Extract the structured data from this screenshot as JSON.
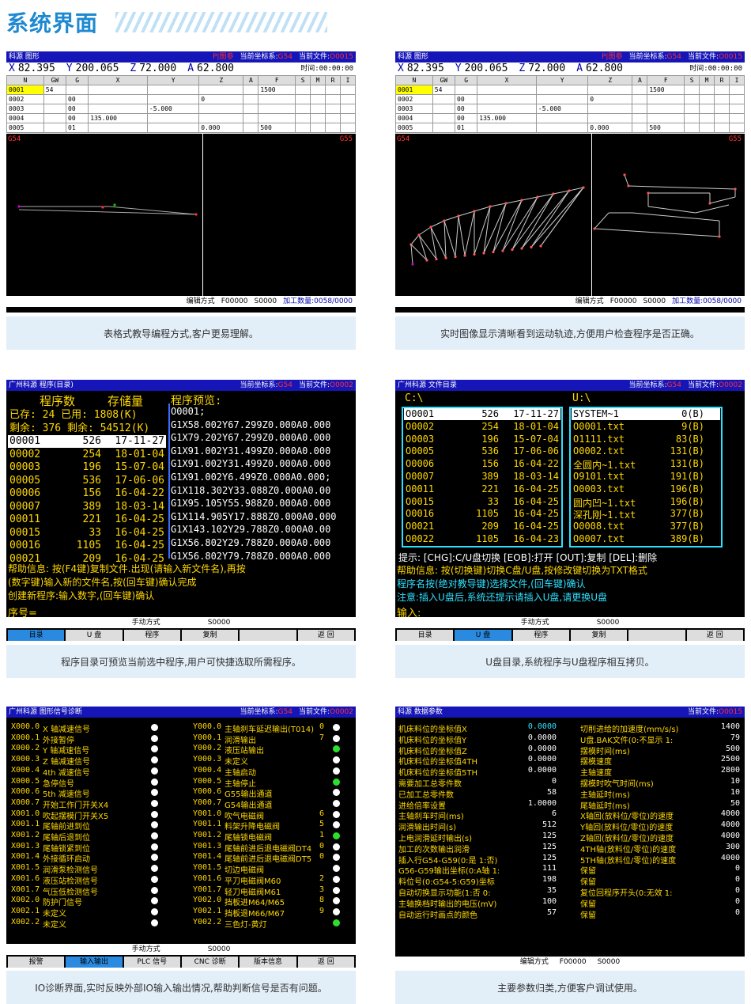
{
  "header": {
    "title": "系统界面"
  },
  "captions": [
    "表格式教导编程方式,客户更易理解。",
    "实时图像显示清晰看到运动轨迹,方便用户检查程序是否正确。",
    "程序目录可预览当前选中程序,用户可快捷选取所需程序。",
    "U盘目录,系统程序与U盘程序相互拷贝。",
    "IO诊断界面,实时反映外部IO输入输出情况,帮助判断信号是否有问题。",
    "主要参数归类,方便客户调试使用。"
  ],
  "graphic": {
    "title": "科源 图形",
    "mode": "P|图参",
    "coord_label": "当前坐标系:",
    "coord_val": "G54",
    "file_label": "当前文件:",
    "file_val": "O0015",
    "x_label": "X",
    "x": "82.395",
    "y_label": "Y",
    "y": "200.065",
    "z_label": "Z",
    "z": "72.000",
    "a_label": "A",
    "a": "62.800",
    "time": "时间:00:00:00",
    "cols": [
      "N",
      "GW",
      "G",
      "X",
      "Y",
      "Z",
      "A",
      "F",
      "S",
      "M",
      "R",
      "I"
    ],
    "rows": [
      [
        "0001",
        "54",
        "",
        "",
        "",
        "",
        "",
        "1500",
        "",
        "",
        "",
        ""
      ],
      [
        "0002",
        "",
        "00",
        "",
        "",
        "0",
        "",
        "",
        "",
        "",
        "",
        ""
      ],
      [
        "0003",
        "",
        "00",
        "",
        "-5.000",
        "",
        "",
        "",
        "",
        "",
        "",
        ""
      ],
      [
        "0004",
        "",
        "00",
        "135.000",
        "",
        "",
        "",
        "",
        "",
        "",
        "",
        ""
      ],
      [
        "0005",
        "",
        "01",
        "",
        "",
        "0.000",
        "",
        "500",
        "",
        "",
        "",
        ""
      ]
    ],
    "view_left": "G54",
    "view_right": "G55",
    "status": [
      "编辑方式",
      "F00000",
      "S0000",
      "加工数量:0058/0000"
    ]
  },
  "proglist": {
    "title": "广州科源 程序(目录)",
    "coord_label": "当前坐标系:",
    "coord_val": "G54",
    "file_label": "当前文件:",
    "file_val": "O0002",
    "h1": "程序数",
    "h2": "存储量",
    "h3": "程序预览:",
    "s1": "已存:   24 已用:  1808(K)",
    "s2": "剩余:  376 剩余: 54512(K)",
    "files": [
      [
        "00001",
        "526",
        "17-11-27"
      ],
      [
        "00002",
        "254",
        "18-01-04"
      ],
      [
        "00003",
        "196",
        "15-07-04"
      ],
      [
        "00005",
        "536",
        "17-06-06"
      ],
      [
        "00006",
        "156",
        "16-04-22"
      ],
      [
        "00007",
        "389",
        "18-03-14"
      ],
      [
        "00011",
        "221",
        "16-04-25"
      ],
      [
        "00015",
        "33",
        "16-04-25"
      ],
      [
        "00016",
        "1105",
        "16-04-25"
      ],
      [
        "00021",
        "209",
        "16-04-25"
      ]
    ],
    "preview": [
      "O0001;",
      "G1X58.002Y67.299Z0.000A0.000",
      "G1X79.202Y67.299Z0.000A0.000",
      "G1X91.002Y31.499Z0.000A0.000",
      "G1X91.002Y31.499Z0.000A0.000",
      "G1X91.002Y6.499Z0.000A0.000;",
      "G1X118.302Y33.088Z0.000A0.00",
      "G1X95.105Y55.988Z0.000A0.000",
      "G1X114.905Y17.888Z0.000A0.000",
      "G1X143.102Y29.788Z0.000A0.00",
      "G1X56.802Y29.788Z0.000A0.000",
      "G1X56.802Y79.788Z0.000A0.000"
    ],
    "help1": "帮助信息: 按(F4键)复制文件.出现(请输入新文件名),再按",
    "help2": "         (数字键)输入新的文件名,按(回车键)确认完成",
    "help3": "         创建新程序:输入数字,(回车键)确认",
    "prompt": "序号=",
    "mode": "手动方式",
    "s": "S0000",
    "buttons": [
      "目录",
      "U 盘",
      "程序",
      "复制",
      "",
      "返 回"
    ]
  },
  "usb": {
    "title": "广州科源 文件目录",
    "coord_label": "当前坐标系:",
    "coord_val": "G54",
    "file_label": "当前文件:",
    "file_val": "O0002",
    "cdrive": "C:\\",
    "udrive": "U:\\",
    "cfiles": [
      [
        "O0001",
        "526",
        "17-11-27"
      ],
      [
        "O0002",
        "254",
        "18-01-04"
      ],
      [
        "O0003",
        "196",
        "15-07-04"
      ],
      [
        "O0005",
        "536",
        "17-06-06"
      ],
      [
        "O0006",
        "156",
        "16-04-22"
      ],
      [
        "O0007",
        "389",
        "18-03-14"
      ],
      [
        "O0011",
        "221",
        "16-04-25"
      ],
      [
        "O0015",
        "33",
        "16-04-25"
      ],
      [
        "O0016",
        "1105",
        "16-04-25"
      ],
      [
        "O0021",
        "209",
        "16-04-25"
      ],
      [
        "O0022",
        "1105",
        "16-04-23"
      ]
    ],
    "ufiles": [
      [
        "SYSTEM~1",
        "0(B)"
      ],
      [
        "O0001.txt",
        "9(B)"
      ],
      [
        "O1111.txt",
        "83(B)"
      ],
      [
        "O0002.txt",
        "131(B)"
      ],
      [
        "全圆内~1.txt",
        "131(B)"
      ],
      [
        "O9101.txt",
        "191(B)"
      ],
      [
        "O0003.txt",
        "196(B)"
      ],
      [
        "圆内凹~1.txt",
        "196(B)"
      ],
      [
        "深孔刚~1.txt",
        "377(B)"
      ],
      [
        "O0008.txt",
        "377(B)"
      ],
      [
        "O0007.txt",
        "389(B)"
      ]
    ],
    "tip": "提示: [CHG]:C/U盘切换 [EOB]:打开 [OUT]:复制 [DEL]:删除",
    "help1": "帮助信息: 按(切换键)切换C盘/U盘,按修改键切换为TXT格式",
    "help2": "         程序名按(绝对教导键)选择文件,(回车键)确认",
    "help3": "         注意:插入U盘后,系统还提示请插入U盘,请更换U盘",
    "prompt": "输入:",
    "mode": "手动方式",
    "s": "S0000",
    "buttons": [
      "目录",
      "U 盘",
      "程序",
      "复制",
      "",
      "返 回"
    ]
  },
  "io": {
    "title": "广州科源 图形信号诊断",
    "coord_label": "当前坐标系:",
    "coord_val": "G54",
    "file_label": "当前文件:",
    "file_val": "O0002",
    "left": [
      [
        "X000.0",
        "X 轴减速信号",
        ""
      ],
      [
        "X000.1",
        "外接暂停",
        ""
      ],
      [
        "X000.2",
        "Y 轴减速信号",
        ""
      ],
      [
        "X000.3",
        "Z 轴减速信号",
        ""
      ],
      [
        "X000.4",
        "4th 减速信号",
        ""
      ],
      [
        "X000.5",
        "急停信号",
        ""
      ],
      [
        "X000.6",
        "5th 减速信号",
        ""
      ],
      [
        "X000.7",
        "开始工作门开关X4",
        ""
      ],
      [
        "X001.0",
        "吹起摆模门开关X5",
        ""
      ],
      [
        "X001.1",
        "尾轴前进到位",
        ""
      ],
      [
        "X001.2",
        "尾轴后退到位",
        ""
      ],
      [
        "X001.3",
        "尾轴锁紧到位",
        ""
      ],
      [
        "X001.4",
        "外接循环启动",
        ""
      ],
      [
        "X001.5",
        "润滑泵检测信号",
        ""
      ],
      [
        "X001.6",
        "液压站检测信号",
        ""
      ],
      [
        "X001.7",
        "气压低检测信号",
        ""
      ],
      [
        "X002.0",
        "防护门信号",
        ""
      ],
      [
        "X002.1",
        "未定义",
        ""
      ],
      [
        "X002.2",
        "未定义",
        ""
      ]
    ],
    "right": [
      [
        "Y000.0",
        "主轴刹车延迟输出(T014)",
        "0"
      ],
      [
        "Y000.1",
        "润滑输出",
        "7"
      ],
      [
        "Y000.2",
        "液压站输出",
        ""
      ],
      [
        "Y000.3",
        "未定义",
        ""
      ],
      [
        "Y000.4",
        "主轴启动",
        ""
      ],
      [
        "Y000.5",
        "主轴停止",
        ""
      ],
      [
        "Y000.6",
        "G55输出通道",
        ""
      ],
      [
        "Y000.7",
        "G54输出通道",
        ""
      ],
      [
        "Y001.0",
        "吹气电磁阀",
        "6"
      ],
      [
        "Y001.1",
        "料架升降电磁阀",
        "5"
      ],
      [
        "Y001.2",
        "尾轴锁电磁阀",
        "1"
      ],
      [
        "Y001.3",
        "尾轴前进后退电磁阀DT4",
        "0"
      ],
      [
        "Y001.4",
        "尾轴前进后退电磁阀DT5",
        "0"
      ],
      [
        "Y001.5",
        "切边电磁阀",
        ""
      ],
      [
        "Y001.6",
        "平刀电磁阀M60",
        "2"
      ],
      [
        "Y001.7",
        "轻刀电磁阀M61",
        "3"
      ],
      [
        "Y002.0",
        "挡板进M64/M65",
        "8"
      ],
      [
        "Y002.1",
        "挡板退M66/M67",
        "9"
      ],
      [
        "Y002.2",
        "三色灯-黄灯",
        ""
      ]
    ],
    "green": [
      2,
      5,
      10,
      18
    ],
    "mode": "手动方式",
    "s": "S0000",
    "buttons": [
      "报警",
      "输入输出",
      "PLC 信号",
      "CNC 诊断",
      "版本信息",
      "返 回"
    ]
  },
  "params": {
    "title": "科源 数据参数",
    "file_label": "当前文件:",
    "file_val": "O0015",
    "left": [
      [
        "机床料位的坐标值X",
        "0.0000"
      ],
      [
        "机床料位的坐标值Y",
        "0.0000"
      ],
      [
        "机床料位的坐标值Z",
        "0.0000"
      ],
      [
        "机床料位的坐标值4TH",
        "0.0000"
      ],
      [
        "机床料位的坐标值5TH",
        "0.0000"
      ],
      [
        "需要加工总零件数",
        "0"
      ],
      [
        "已加工总零件数",
        "58"
      ],
      [
        "进给倍率设置",
        "1.0000"
      ],
      [
        "主轴刹车时间(ms)",
        "6"
      ],
      [
        "润滑输出时间(s)",
        "512"
      ],
      [
        "上电润滑延时输出(s)",
        "125"
      ],
      [
        "加工的次数输出润滑",
        "125"
      ],
      [
        "插入行G54-G59(0:是 1:否)",
        "125"
      ],
      [
        "G56-G59输出坐标(0:A轴 1:",
        "111"
      ],
      [
        "料位号(0:G54-5:G59)坐标",
        "198"
      ],
      [
        "自动切换显示功能(1:否 0:",
        "35"
      ],
      [
        "主轴换档时输出的电压(mV)",
        "100"
      ],
      [
        "自动运行时画点的颜色",
        "57"
      ]
    ],
    "right": [
      [
        "切削进给的加速度(mm/s/s)",
        "1400"
      ],
      [
        "U盘.BAK文件(0:不显示 1:",
        "79"
      ],
      [
        "摆模时间(ms)",
        "500"
      ],
      [
        "摆模速度",
        "2500"
      ],
      [
        "主轴速度",
        "2800"
      ],
      [
        "摆模时吹气时间(ms)",
        "10"
      ],
      [
        "主轴延时(ms)",
        "10"
      ],
      [
        "尾轴延时(ms)",
        "50"
      ],
      [
        "X轴回(放料位/零位)的速度",
        "4000"
      ],
      [
        "Y轴回(放料位/零位)的速度",
        "4000"
      ],
      [
        "Z轴回(放料位/零位)的速度",
        "4000"
      ],
      [
        "4TH轴(放料位/零位)的速度",
        "300"
      ],
      [
        "5TH轴(放料位/零位)的速度",
        "4000"
      ],
      [
        "保留",
        "0"
      ],
      [
        "保留",
        "0"
      ],
      [
        "复位回程序开头(0:无效 1:",
        "0"
      ],
      [
        "保留",
        "0"
      ],
      [
        "保留",
        "0"
      ]
    ],
    "status": [
      "编辑方式",
      "F00000",
      "S0000"
    ]
  }
}
